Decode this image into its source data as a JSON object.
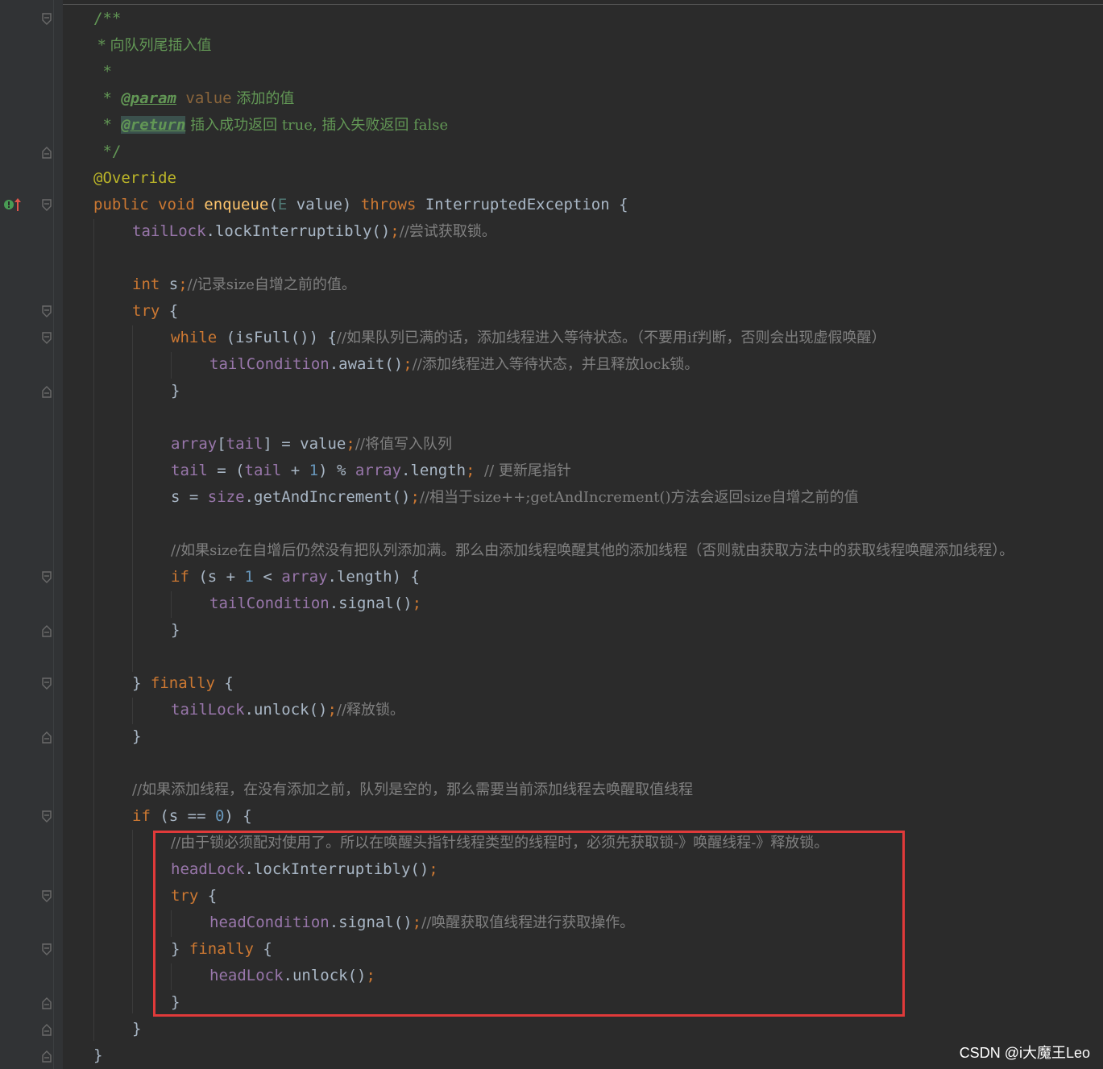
{
  "code": {
    "l1": "/**",
    "l2": " * 向队列尾插入值",
    "l3": " *",
    "l4_star": " * ",
    "l4_tag": "@param",
    "l4_name": " value",
    "l4_text": " 添加的值",
    "l5_star": " * ",
    "l5_tag": "@return",
    "l5_text": " 插入成功返回 true, 插入失败返回 false",
    "l6": " */",
    "l7": "@Override",
    "l8_kw": "public void ",
    "l8_fn": "enqueue",
    "l8_p1": "(",
    "l8_type": "E",
    "l8_p2": " value) ",
    "l8_throws": "throws",
    "l8_rest": " InterruptedException {",
    "l9_fld": "tailLock",
    "l9_call": ".lockInterruptibly()",
    "l9_semi": ";",
    "l9_cm": "//尝试获取锁。",
    "l10_kw": "int",
    "l10_var": " s",
    "l10_semi": ";",
    "l10_cm": "//记录size自增之前的值。",
    "l11_kw": "try",
    "l11_rest": " {",
    "l12_kw": "while",
    "l12_rest": " (isFull()) {",
    "l12_cm": "//如果队列已满的话，添加线程进入等待状态。（不要用if判断，否则会出现虚假唤醒）",
    "l13_fld": "tailCondition",
    "l13_call": ".await()",
    "l13_semi": ";",
    "l13_cm": "//添加线程进入等待状态，并且释放lock锁。",
    "l14": "}",
    "l15_fld1": "array",
    "l15_b1": "[",
    "l15_fld2": "tail",
    "l15_b2": "] = value",
    "l15_semi": ";",
    "l15_cm": "//将值写入队列",
    "l16_fld1": "tail",
    "l16_a": " = (",
    "l16_fld2": "tail",
    "l16_b": " + ",
    "l16_num": "1",
    "l16_c": ") % ",
    "l16_fld3": "array",
    "l16_d": ".length",
    "l16_semi": "; ",
    "l16_cm": "// 更新尾指针",
    "l17_a": "s = ",
    "l17_fld": "size",
    "l17_call": ".getAndIncrement()",
    "l17_semi": ";",
    "l17_cm": "//相当于size++;getAndIncrement()方法会返回size自增之前的值",
    "l18_cm": "//如果size在自增后仍然没有把队列添加满。那么由添加线程唤醒其他的添加线程（否则就由获取方法中的获取线程唤醒添加线程）。",
    "l19_kw": "if",
    "l19_a": " (s + ",
    "l19_num": "1",
    "l19_b": " < ",
    "l19_fld": "array",
    "l19_c": ".length) {",
    "l20_fld": "tailCondition",
    "l20_call": ".signal()",
    "l20_semi": ";",
    "l21": "}",
    "l22_a": "} ",
    "l22_kw": "finally",
    "l22_b": " {",
    "l23_fld": "tailLock",
    "l23_call": ".unlock()",
    "l23_semi": ";",
    "l23_cm": "//释放锁。",
    "l24": "}",
    "l25_cm": "//如果添加线程，在没有添加之前，队列是空的，那么需要当前添加线程去唤醒取值线程",
    "l26_kw": "if",
    "l26_a": " (s == ",
    "l26_num": "0",
    "l26_b": ") {",
    "l27_cm": "//由于锁必须配对使用了。所以在唤醒头指针线程类型的线程时，必须先获取锁-》唤醒线程-》释放锁。",
    "l28_fld": "headLock",
    "l28_call": ".lockInterruptibly()",
    "l28_semi": ";",
    "l29_kw": "try",
    "l29_rest": " {",
    "l30_fld": "headCondition",
    "l30_call": ".signal()",
    "l30_semi": ";",
    "l30_cm": "//唤醒获取值线程进行获取操作。",
    "l31_a": "} ",
    "l31_kw": "finally",
    "l31_b": " {",
    "l32_fld": "headLock",
    "l32_call": ".unlock()",
    "l32_semi": ";",
    "l33": "}",
    "l34": "}",
    "l35": "}"
  },
  "watermark": "CSDN @i大魔王Leo",
  "colors": {
    "background": "#2b2b2b",
    "keyword": "#cc7832",
    "field": "#9876aa",
    "function": "#ffc66d",
    "comment": "#808080",
    "doc": "#629755",
    "annotation": "#bbb529",
    "number": "#6897bb",
    "highlight_box": "#e03a3a"
  },
  "icons": [
    "fold-icon",
    "override-marker-icon"
  ]
}
